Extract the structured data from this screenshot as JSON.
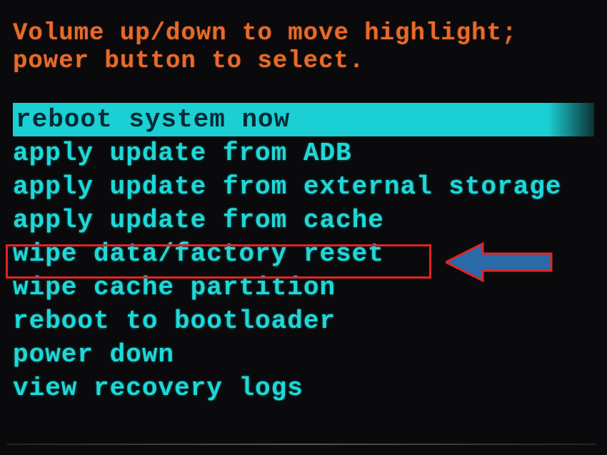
{
  "instructions": {
    "line1": "Volume up/down to move highlight;",
    "line2": "power button to select."
  },
  "menu": {
    "items": [
      {
        "label": "reboot system now",
        "selected": true
      },
      {
        "label": "apply update from ADB",
        "selected": false
      },
      {
        "label": "apply update from external storage",
        "selected": false
      },
      {
        "label": "apply update from cache",
        "selected": false
      },
      {
        "label": "wipe data/factory reset",
        "selected": false
      },
      {
        "label": "wipe cache partition",
        "selected": false
      },
      {
        "label": "reboot to bootloader",
        "selected": false
      },
      {
        "label": "power down",
        "selected": false
      },
      {
        "label": "view recovery logs",
        "selected": false
      }
    ]
  },
  "annotation": {
    "target_index": 4,
    "arrow_color": "#2a6aa8",
    "box_border_color": "#e22424"
  }
}
